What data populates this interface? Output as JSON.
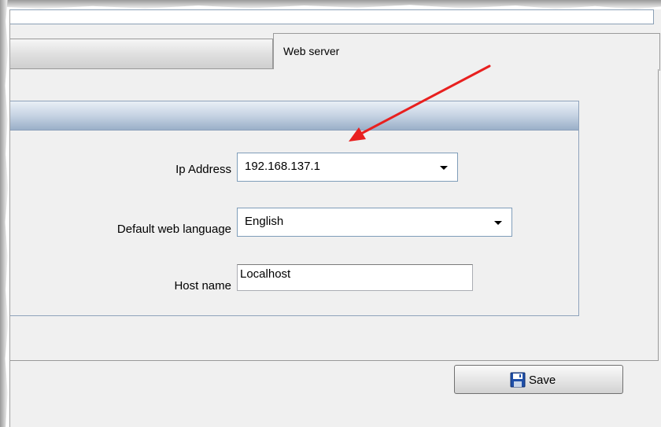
{
  "tabs": {
    "active_label": "Web server"
  },
  "fields": {
    "ip_address": {
      "label": "Ip Address",
      "value": "192.168.137.1"
    },
    "default_web_language": {
      "label": "Default web language",
      "value": "English"
    },
    "host_name": {
      "label": "Host name",
      "value": "Localhost"
    }
  },
  "buttons": {
    "save_label": "Save"
  },
  "icons": {
    "dropdown": "chevron-down-icon",
    "save": "floppy-disk-icon",
    "annotation": "arrow-icon"
  },
  "colors": {
    "annotation_arrow": "#e8201f",
    "group_header": "#b3c4da",
    "save_icon": "#1f4fa8"
  }
}
